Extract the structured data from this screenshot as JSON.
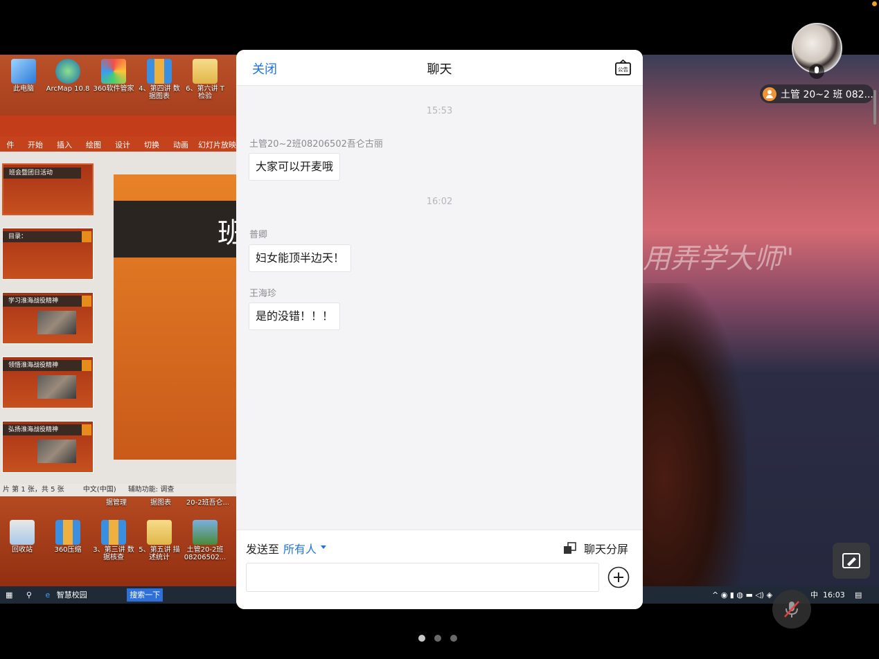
{
  "chat": {
    "close_label": "关闭",
    "title": "聊天",
    "notice_label": "公告",
    "messages": [
      {
        "type": "timestamp",
        "text": "15:53"
      },
      {
        "type": "message",
        "sender": "土管20~2班08206502吾仑古丽",
        "text": "大家可以开麦哦"
      },
      {
        "type": "timestamp",
        "text": "16:02"
      },
      {
        "type": "message",
        "sender": "普卿",
        "text": "妇女能顶半边天！"
      },
      {
        "type": "message",
        "sender": "王海珍",
        "text": "是的没错！！！"
      }
    ],
    "composer": {
      "send_to_label": "发送至",
      "send_to_target": "所有人",
      "split_label": "聊天分屏",
      "input_value": "",
      "input_placeholder": ""
    }
  },
  "participant": {
    "name": "土管 20~2 班 082..."
  },
  "shared_screen": {
    "desktop_icons_top": [
      "此电脑",
      "ArcMap 10.8",
      "360软件管家",
      "4、第四讲 数据图表",
      "6、第六讲 T检验"
    ],
    "desktop_icons_bottom": [
      "回收站",
      "360压缩",
      "3、第三讲 数据核查",
      "5、第五讲 描述统计",
      "土管20-2班08206502..."
    ],
    "desktop_icons_bottom_partial": [
      "据管理",
      "据图表",
      "20-2班吾仑..."
    ],
    "ribbon_tabs": [
      "件",
      "开始",
      "插入",
      "绘图",
      "设计",
      "切换",
      "动画",
      "幻灯片放映"
    ],
    "slide_titles": [
      "班会暨团日活动",
      "目录：",
      "学习淮海战役精神",
      "领悟淮海战役精神",
      "弘扬淮海战役精神"
    ],
    "slide_main_char": "班",
    "status_bar": [
      "片 第 1 张，共 5 张",
      "中文(中国)",
      "辅助功能: 调查"
    ],
    "taskbar_search": "智慧校园",
    "taskbar_search_btn": "搜索一下",
    "taskbar_time": "16:03",
    "taskbar_ime": "中"
  },
  "camera": {
    "overlay_text": "用弄学大师\""
  },
  "pager": {
    "count": 3,
    "active": 0
  },
  "colors": {
    "accent": "#1e72e6",
    "panel_bg": "#f4f4f6",
    "avatar_badge": "#f09335"
  }
}
